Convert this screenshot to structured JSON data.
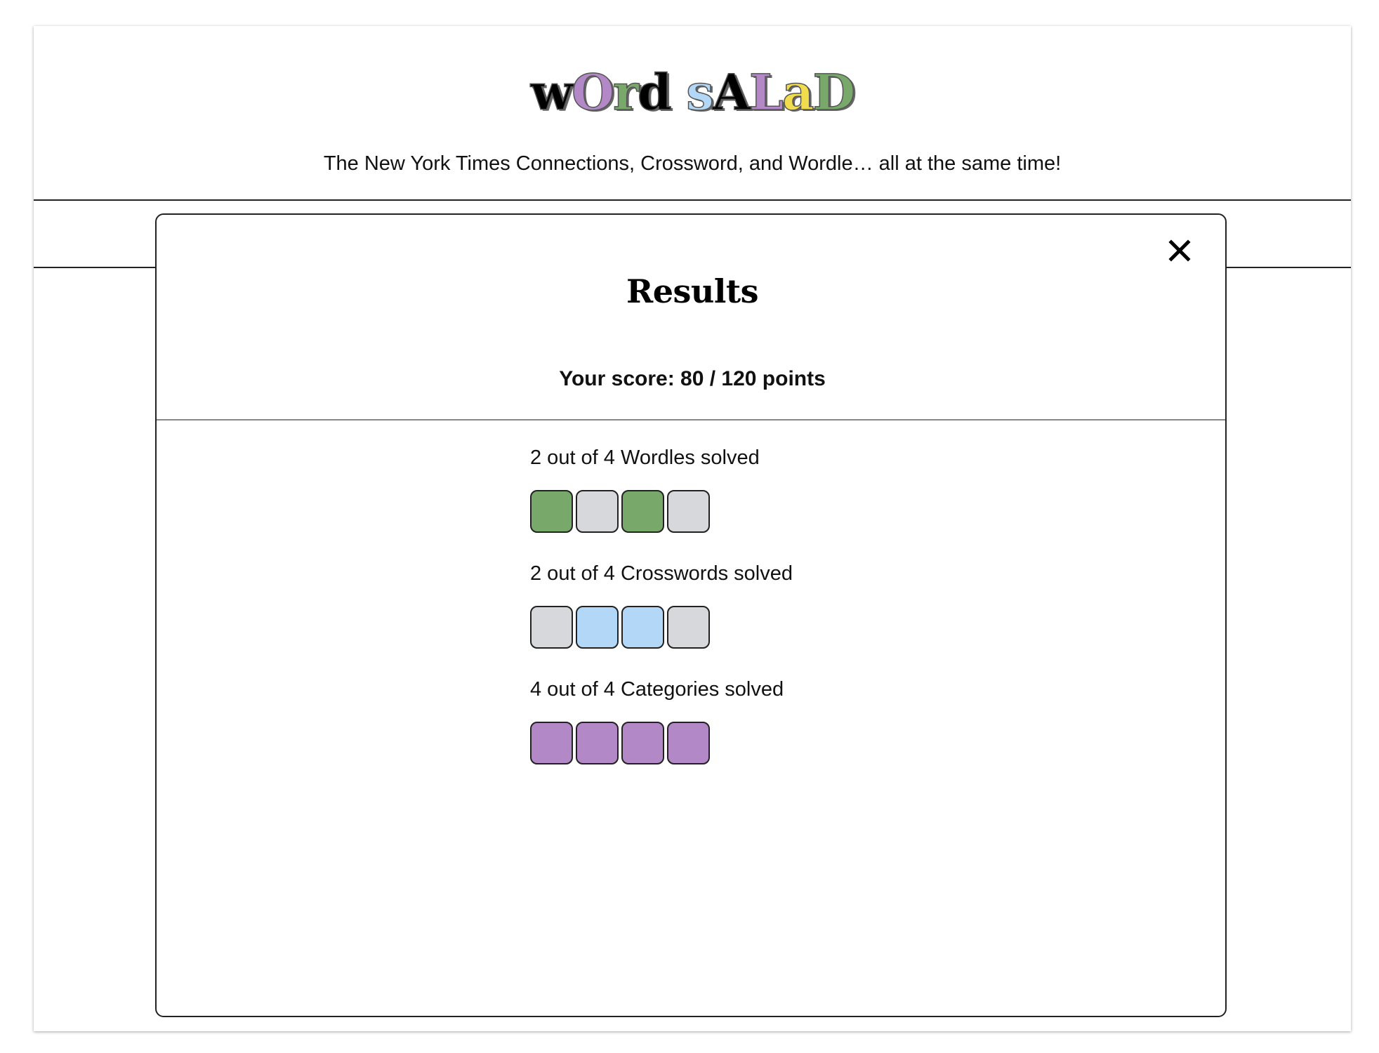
{
  "logo": {
    "letters": [
      {
        "char": "w",
        "color": "#000000"
      },
      {
        "char": "O",
        "color": "#b388c6"
      },
      {
        "char": "r",
        "color": "#78a96b"
      },
      {
        "char": "d",
        "color": "#000000"
      },
      {
        "char": " ",
        "color": "#000000"
      },
      {
        "char": "s",
        "color": "#b3d8f7"
      },
      {
        "char": "A",
        "color": "#000000"
      },
      {
        "char": "L",
        "color": "#b388c6"
      },
      {
        "char": "a",
        "color": "#f1dc4d"
      },
      {
        "char": "D",
        "color": "#78a96b"
      }
    ]
  },
  "header": {
    "tagline": "The New York Times Connections, Crossword, and Wordle… all at the same time!"
  },
  "modal": {
    "title": "Results",
    "close_icon": "close-icon",
    "score_text": "Your score: 80 / 120 points",
    "results": [
      {
        "label": "2 out of 4 Wordles solved",
        "tiles": [
          "#78a96b",
          "#d7d8db",
          "#78a96b",
          "#d7d8db"
        ]
      },
      {
        "label": "2 out of 4 Crosswords solved",
        "tiles": [
          "#d7d8db",
          "#b3d8f7",
          "#b3d8f7",
          "#d7d8db"
        ]
      },
      {
        "label": "4 out of 4 Categories solved",
        "tiles": [
          "#b388c6",
          "#b388c6",
          "#b388c6",
          "#b388c6"
        ]
      }
    ]
  }
}
